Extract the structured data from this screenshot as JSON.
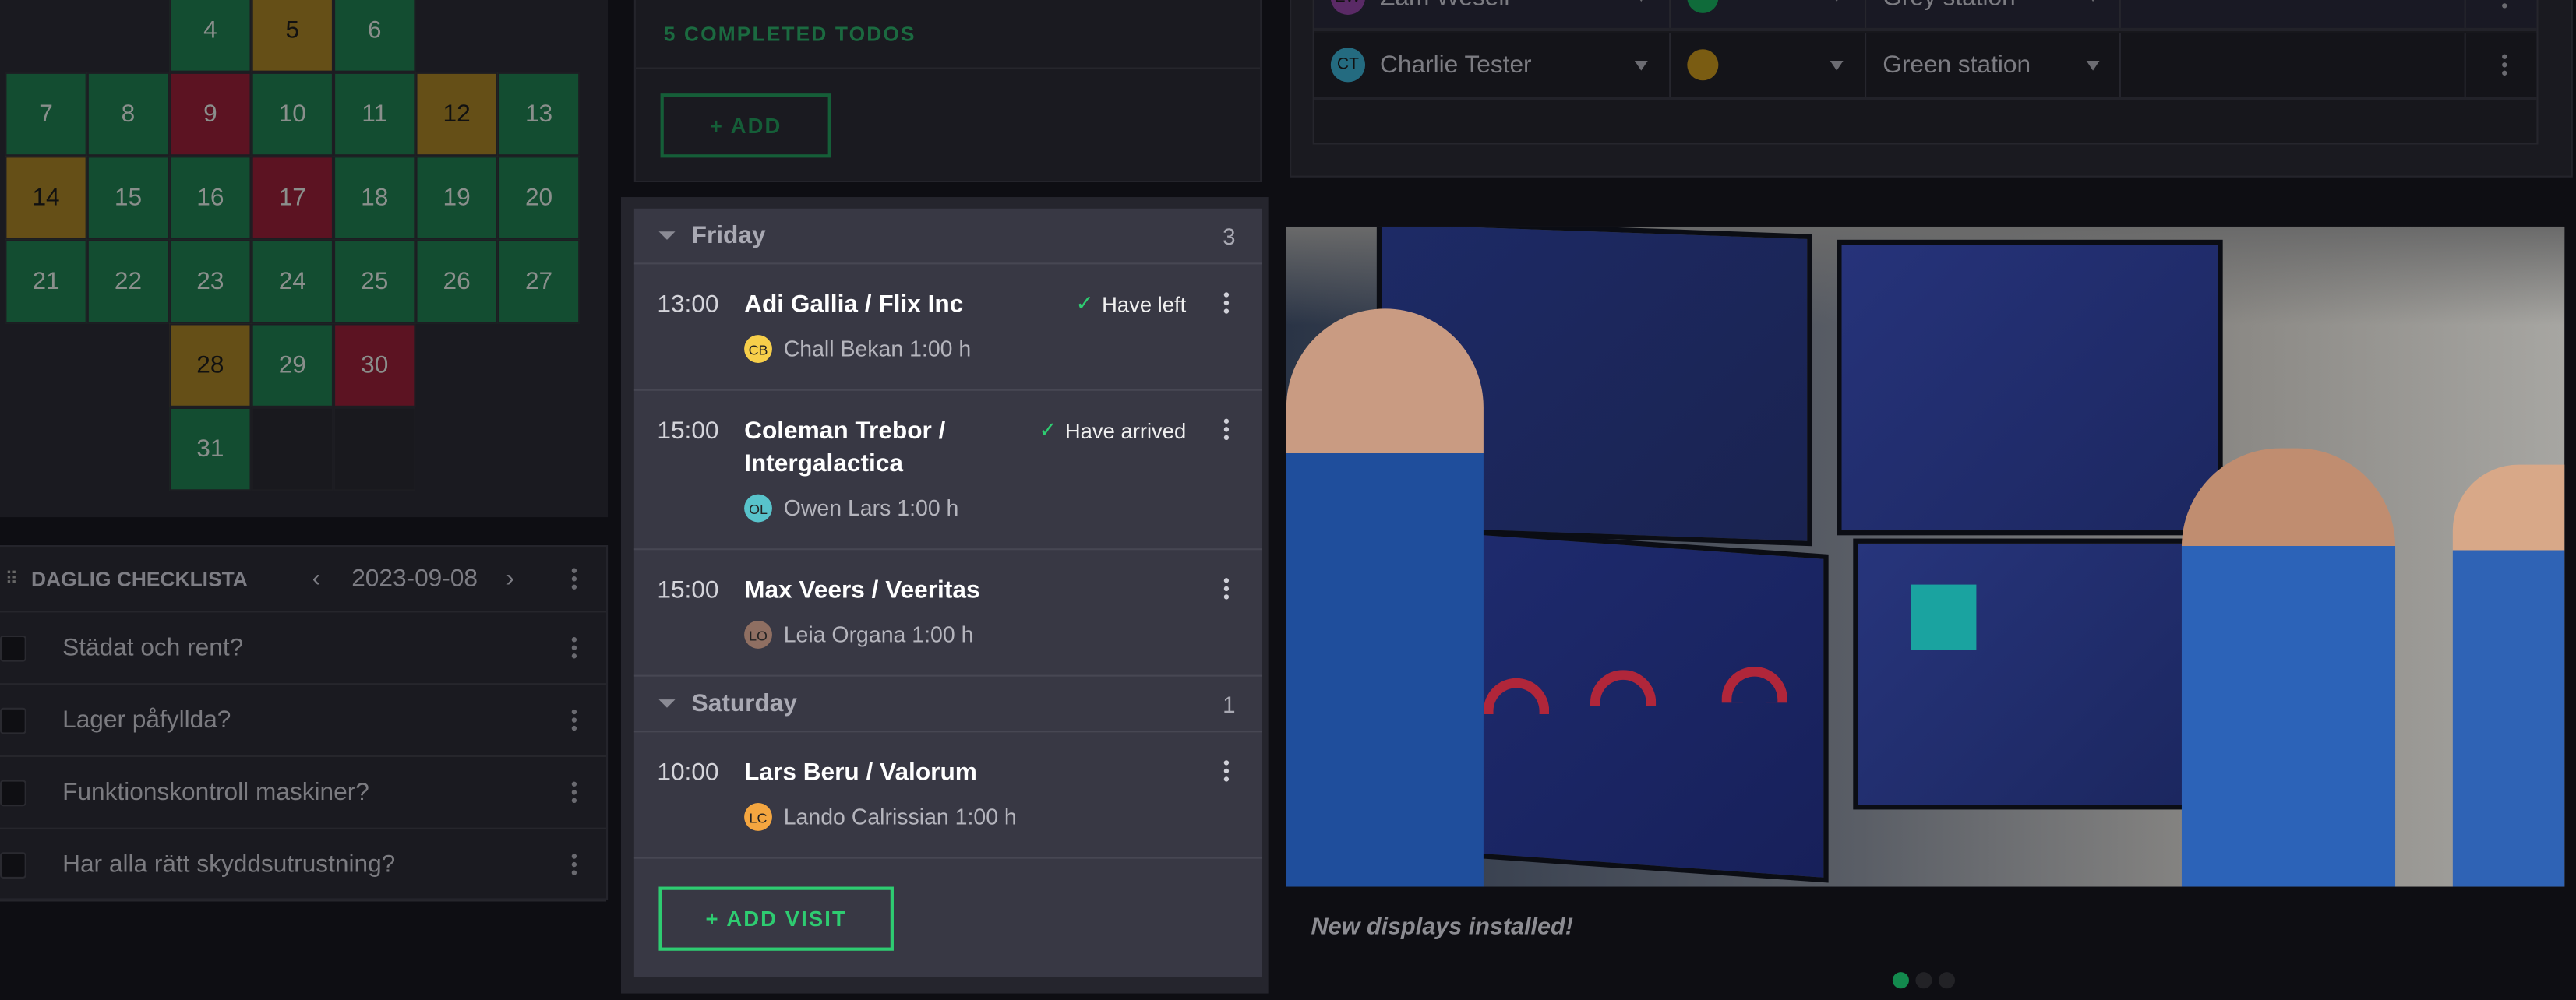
{
  "calendar": {
    "days": [
      {
        "day": "4",
        "status": "green"
      },
      {
        "day": "5",
        "status": "yellow"
      },
      {
        "day": "6",
        "status": "green"
      },
      {
        "day": "7",
        "status": "green"
      },
      {
        "day": "8",
        "status": "green"
      },
      {
        "day": "9",
        "status": "red"
      },
      {
        "day": "10",
        "status": "green"
      },
      {
        "day": "11",
        "status": "green"
      },
      {
        "day": "12",
        "status": "yellow"
      },
      {
        "day": "13",
        "status": "green"
      },
      {
        "day": "14",
        "status": "yellow"
      },
      {
        "day": "15",
        "status": "green"
      },
      {
        "day": "16",
        "status": "green"
      },
      {
        "day": "17",
        "status": "red"
      },
      {
        "day": "18",
        "status": "green"
      },
      {
        "day": "19",
        "status": "green"
      },
      {
        "day": "20",
        "status": "green"
      },
      {
        "day": "21",
        "status": "green"
      },
      {
        "day": "22",
        "status": "green"
      },
      {
        "day": "23",
        "status": "green"
      },
      {
        "day": "24",
        "status": "green"
      },
      {
        "day": "25",
        "status": "green"
      },
      {
        "day": "26",
        "status": "green"
      },
      {
        "day": "27",
        "status": "green"
      },
      {
        "day": "28",
        "status": "yellow"
      },
      {
        "day": "29",
        "status": "green"
      },
      {
        "day": "30",
        "status": "red"
      },
      {
        "day": "31",
        "status": "green"
      }
    ],
    "colors": {
      "green": "#134d31",
      "yellow": "#654f17",
      "red": "#5c1322"
    }
  },
  "checklist": {
    "title": "DAGLIG CHECKLISTA",
    "date": "2023-09-08",
    "items": [
      {
        "label": "Städat och rent?",
        "checked": false
      },
      {
        "label": "Lager påfyllda?",
        "checked": false
      },
      {
        "label": "Funktionskontroll maskiner?",
        "checked": false
      },
      {
        "label": "Har alla rätt skyddsutrustning?",
        "checked": false
      }
    ]
  },
  "todos": {
    "completed_label": "5 COMPLETED TODOS",
    "add_label": "+ ADD"
  },
  "visits": {
    "days": [
      {
        "name": "Friday",
        "count": "3",
        "visits": [
          {
            "time": "13:00",
            "title": "Adi Gallia / Flix Inc",
            "host_initials": "CB",
            "host": "Chall Bekan 1:00 h",
            "host_color": "#f7cf4a",
            "status": "Have left"
          },
          {
            "time": "15:00",
            "title": "Coleman Trebor / Intergalactica",
            "host_initials": "OL",
            "host": "Owen Lars 1:00 h",
            "host_color": "#58c3cb",
            "status": "Have arrived"
          },
          {
            "time": "15:00",
            "title": "Max Veers / Veeritas",
            "host_initials": "LO",
            "host": "Leia Organa 1:00 h",
            "host_color": "#8f6f62",
            "status": ""
          }
        ]
      },
      {
        "name": "Saturday",
        "count": "1",
        "visits": [
          {
            "time": "10:00",
            "title": "Lars Beru / Valorum",
            "host_initials": "LC",
            "host": "Lando Calrissian 1:00 h",
            "host_color": "#f4a640",
            "status": ""
          }
        ]
      }
    ],
    "add_label": "+ ADD VISIT",
    "accent": "#2ecc71"
  },
  "stations": {
    "rows": [
      {
        "initials": "ZW",
        "name": "Zam Wesell",
        "avatar_color": "#5a2a66",
        "status_color": "#0f6b3a",
        "station": "Grey station"
      },
      {
        "initials": "CT",
        "name": "Charlie Tester",
        "avatar_color": "#246b80",
        "status_color": "#7a5c12",
        "station": "Green station"
      }
    ]
  },
  "news": {
    "caption": "New displays installed!",
    "slide_count": 3,
    "active_slide": 1,
    "active_dot_color": "#138a4e"
  }
}
